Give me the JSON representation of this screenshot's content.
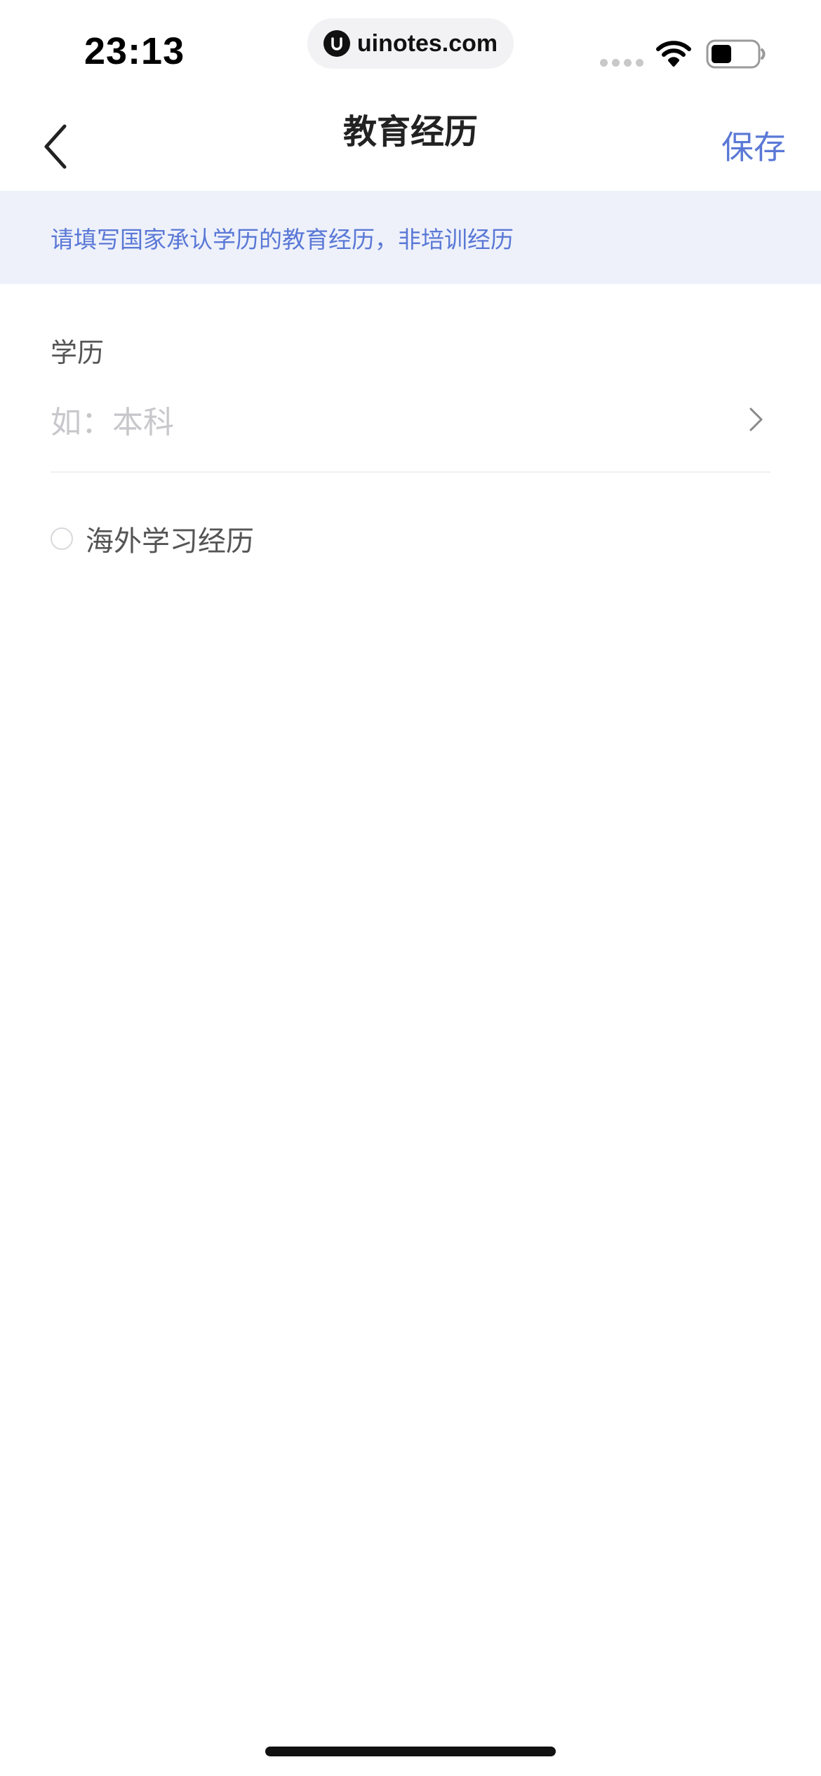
{
  "status_bar": {
    "time": "23:13",
    "url": "uinotes.com",
    "icons": [
      "signal-dots-icon",
      "wifi-icon",
      "battery-icon"
    ]
  },
  "nav": {
    "title": "教育经历",
    "save_label": "保存",
    "back_icon": "chevron-left-icon"
  },
  "notice": {
    "text": "请填写国家承认学历的教育经历，非培训经历"
  },
  "degree": {
    "label": "学历",
    "placeholder": "如：本科",
    "value": ""
  },
  "overseas": {
    "label": "海外学习经历",
    "checked": false
  },
  "colors": {
    "accent": "#5a78d6",
    "banner_bg": "#eef1fa",
    "placeholder": "#c8c8cc"
  }
}
